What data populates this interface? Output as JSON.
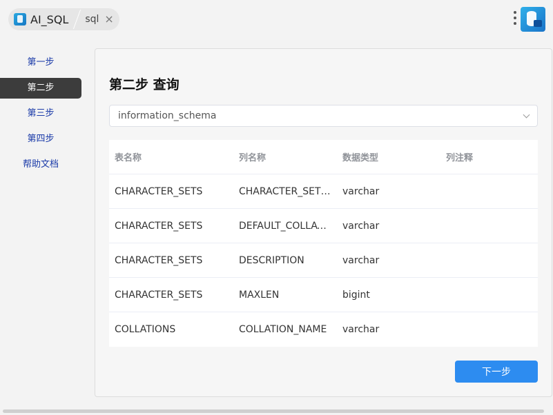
{
  "header": {
    "app_label": "AI_SQL",
    "tab_label": "sql",
    "close_glyph": "×"
  },
  "sidebar": {
    "items": [
      {
        "label": "第一步",
        "active": false
      },
      {
        "label": "第二步",
        "active": true
      },
      {
        "label": "第三步",
        "active": false
      },
      {
        "label": "第四步",
        "active": false
      },
      {
        "label": "帮助文档",
        "active": false
      }
    ]
  },
  "main": {
    "title": "第二步 查询",
    "database_select": {
      "value": "information_schema"
    },
    "table": {
      "headers": [
        "表名称",
        "列名称",
        "数据类型",
        "列注释"
      ],
      "rows": [
        [
          "CHARACTER_SETS",
          "CHARACTER_SET_NAME",
          "varchar",
          ""
        ],
        [
          "CHARACTER_SETS",
          "DEFAULT_COLLATE_NAME",
          "varchar",
          ""
        ],
        [
          "CHARACTER_SETS",
          "DESCRIPTION",
          "varchar",
          ""
        ],
        [
          "CHARACTER_SETS",
          "MAXLEN",
          "bigint",
          ""
        ],
        [
          "COLLATIONS",
          "COLLATION_NAME",
          "varchar",
          ""
        ]
      ]
    },
    "next_button_label": "下一步"
  },
  "colors": {
    "accent": "#2d8cf0",
    "nav_active_bg": "#3c3c3c",
    "nav_text": "#1a3aa8"
  }
}
